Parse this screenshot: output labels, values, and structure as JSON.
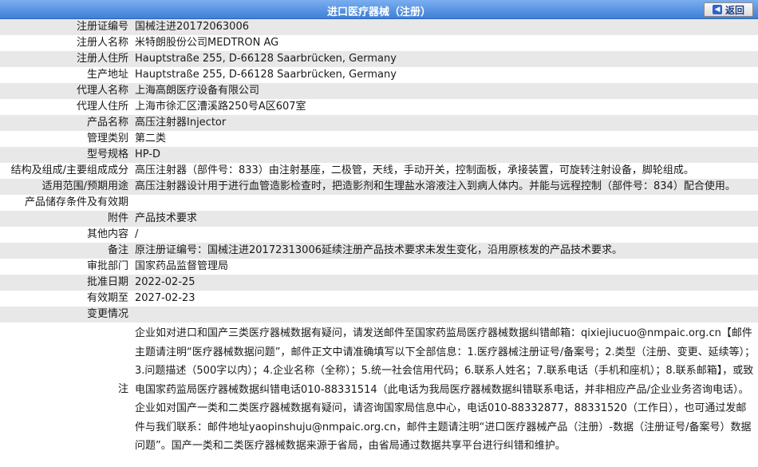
{
  "header": {
    "title": "进口医疗器械（注册）",
    "back_label": "返回"
  },
  "rows": [
    {
      "label": "注册证编号",
      "value": "国械注进20172063006"
    },
    {
      "label": "注册人名称",
      "value": "米特朗股份公司MEDTRON AG"
    },
    {
      "label": "注册人住所",
      "value": "Hauptstraße 255, D-66128 Saarbrücken, Germany"
    },
    {
      "label": "生产地址",
      "value": "Hauptstraße 255, D-66128 Saarbrücken, Germany"
    },
    {
      "label": "代理人名称",
      "value": "上海高朗医疗设备有限公司"
    },
    {
      "label": "代理人住所",
      "value": "上海市徐汇区漕溪路250号A区607室"
    },
    {
      "label": "产品名称",
      "value": "高压注射器Injector"
    },
    {
      "label": "管理类别",
      "value": "第二类"
    },
    {
      "label": "型号规格",
      "value": "HP-D"
    },
    {
      "label": "结构及组成/主要组成成分",
      "value": "高压注射器（部件号：833）由注射基座，二极管，天线，手动开关，控制面板，承接装置，可旋转注射设备，脚轮组成。"
    },
    {
      "label": "适用范围/预期用途",
      "value": "高压注射器设计用于进行血管造影检查时，把造影剂和生理盐水溶液注入到病人体内。并能与远程控制（部件号：834）配合使用。"
    },
    {
      "label": "产品储存条件及有效期",
      "value": ""
    },
    {
      "label": "附件",
      "value": "产品技术要求"
    },
    {
      "label": "其他内容",
      "value": "/"
    },
    {
      "label": "备注",
      "value": "原注册证编号：国械注进20172313006延续注册产品技术要求未发生变化，沿用原核发的产品技术要求。"
    },
    {
      "label": "审批部门",
      "value": "国家药品监督管理局"
    },
    {
      "label": "批准日期",
      "value": "2022-02-25"
    },
    {
      "label": "有效期至",
      "value": "2027-02-23"
    },
    {
      "label": "变更情况",
      "value": ""
    }
  ],
  "note": {
    "label": "注",
    "text": "企业如对进口和国产三类医疗器械数据有疑问，请发送邮件至国家药监局医疗器械数据纠错邮箱：qixiejiucuo@nmpaic.org.cn【邮件主题请注明“医疗器械数据问题”，邮件正文中请准确填写以下全部信息：1.医疗器械注册证号/备案号；2.类型（注册、变更、延续等）；3.问题描述（500字以内）；4.企业名称（全称）；5.统一社会信用代码；6.联系人姓名；7.联系电话（手机和座机）；8.联系邮箱】，或致电国家药监局医疗器械数据纠错电话010-88331514（此电话为我局医疗器械数据纠错联系电话，并非相应产品/企业业务咨询电话）。企业如对国产一类和二类医疗器械数据有疑问，请咨询国家局信息中心，电话010-88332877，88331520（工作日），也可通过发邮件与我们联系：邮件地址yaopinshuju@nmpaic.org.cn，邮件主题请注明“进口医疗器械产品（注册）-数据（注册证号/备案号）数据问题”。国产一类和二类医疗器械数据来源于省局，由省局通过数据共享平台进行纠错和维护。"
  }
}
